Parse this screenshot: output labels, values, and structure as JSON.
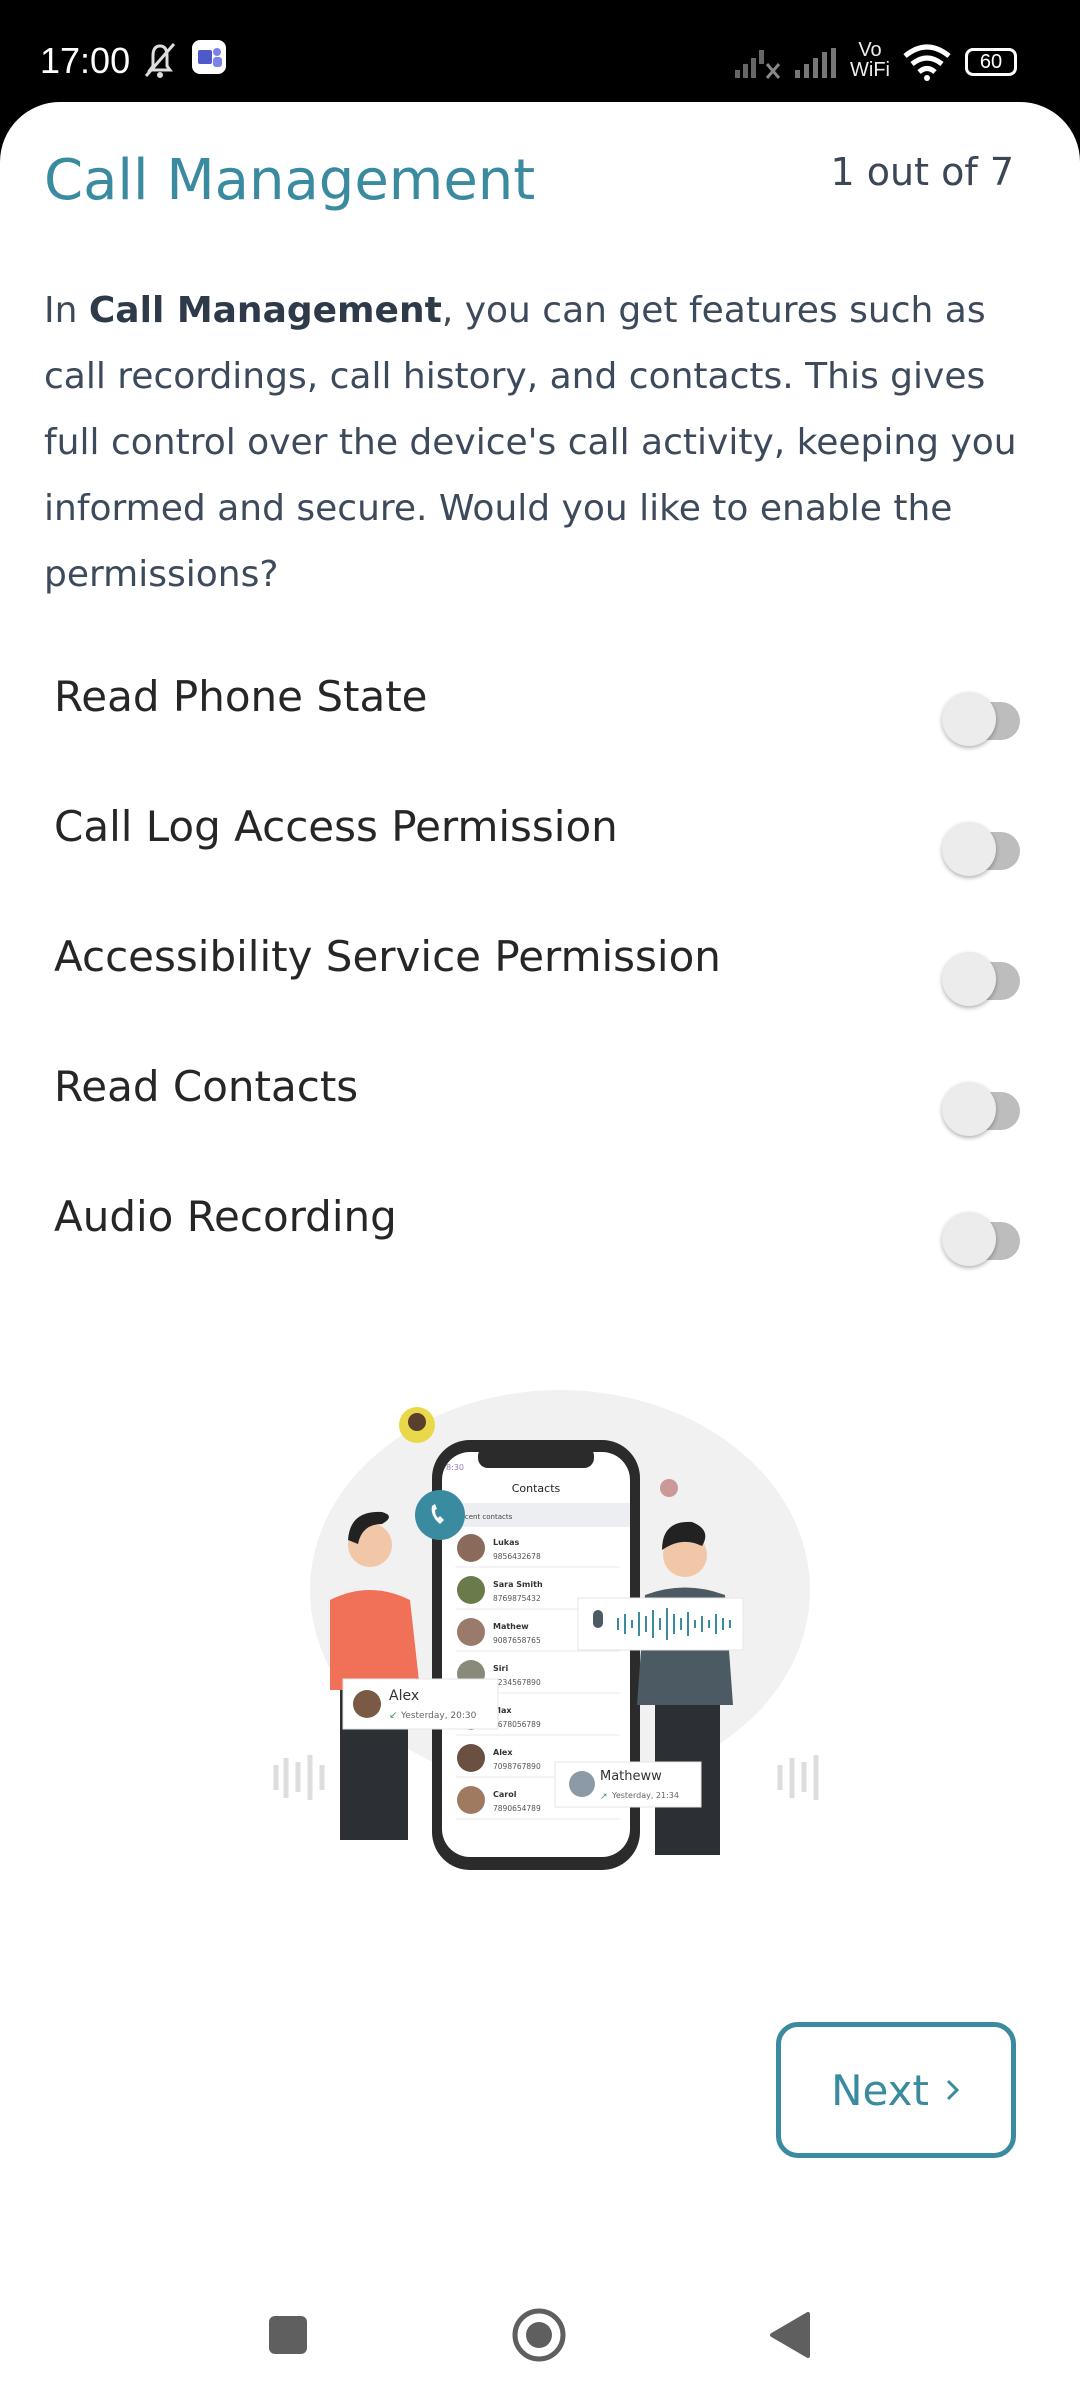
{
  "status_bar": {
    "time": "17:00",
    "battery": "60",
    "network_label_top": "Vo",
    "network_label_bottom": "WiFi",
    "icons": [
      "bell-off-icon",
      "teams-icon",
      "signal-off-icon",
      "signal-icon",
      "vowifi-icon",
      "wifi-icon",
      "battery-icon"
    ]
  },
  "header": {
    "title": "Call Management",
    "step": "1 out of 7"
  },
  "description": {
    "prefix": "In ",
    "bold": "Call Management",
    "suffix": ", you can get features such as call recordings, call history, and contacts. This gives full control over the device's call activity, keeping you informed and secure. Would you like to enable the permissions?"
  },
  "permissions": [
    {
      "label": "Read Phone State",
      "enabled": false
    },
    {
      "label": "Call Log Access Permission",
      "enabled": false
    },
    {
      "label": "Accessibility Service Permission",
      "enabled": false
    },
    {
      "label": "Read Contacts",
      "enabled": false
    },
    {
      "label": "Audio Recording",
      "enabled": false
    }
  ],
  "illustration": {
    "phone_time": "8:30",
    "phone_title": "Contacts",
    "section": "Recent contacts",
    "contacts": [
      {
        "name": "Lukas",
        "number": "9856432678"
      },
      {
        "name": "Sara Smith",
        "number": "8769875432"
      },
      {
        "name": "Mathew",
        "number": "9087658765"
      },
      {
        "name": "Siri",
        "number": "1234567890"
      },
      {
        "name": "Max",
        "number": "9678056789"
      },
      {
        "name": "Alex",
        "number": "7098767890"
      },
      {
        "name": "Carol",
        "number": "7890654789"
      }
    ],
    "card_left": {
      "name": "Alex",
      "time": "Yesterday, 20:30"
    },
    "card_right": {
      "name": "Matheww",
      "time": "Yesterday, 21:34"
    }
  },
  "actions": {
    "next_label": "Next",
    "next_icon": "chevron-right-icon"
  },
  "nav": [
    "recents-square-icon",
    "home-circle-icon",
    "back-triangle-icon"
  ],
  "colors": {
    "accent": "#3a8aa0",
    "text": "#3d4a5c",
    "toggle_track": "#bdbdbd",
    "toggle_thumb": "#ececec"
  }
}
